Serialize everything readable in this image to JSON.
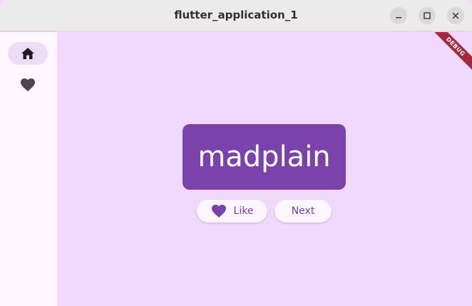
{
  "window": {
    "title": "flutter_application_1",
    "controls": {
      "minimize": "minimize-icon",
      "maximize": "maximize-icon",
      "close": "close-icon"
    }
  },
  "rail": {
    "items": [
      {
        "icon": "home-icon",
        "selected": true
      },
      {
        "icon": "heart-icon",
        "selected": false
      }
    ]
  },
  "main": {
    "word": "madplain",
    "like_label": "Like",
    "next_label": "Next"
  },
  "debug_banner": "DEBUG",
  "colors": {
    "background": "#f0d9fb",
    "rail": "#fef7ff",
    "card": "#7b42ab",
    "accent": "#6f3fa1",
    "banner": "#a5283f"
  }
}
